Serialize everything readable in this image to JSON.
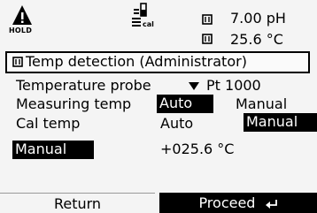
{
  "status": {
    "hold_label": "HOLD",
    "cal_label": "cal",
    "reading_1": "7.00 pH",
    "reading_2": "25.6 °C",
    "icons": [
      "warning-icon",
      "calibration-icon",
      "measurement-icon"
    ]
  },
  "title": {
    "text": "Temp detection (Administrator)"
  },
  "rows": {
    "probe_label": "Temperature probe",
    "probe_value": "Pt 1000",
    "measuring_label": "Measuring temp",
    "measuring_opt_1": "Auto",
    "measuring_opt_2": "Manual",
    "cal_label": "Cal temp",
    "cal_opt_1": "Auto",
    "cal_opt_2": "Manual",
    "manual_field": "Manual",
    "manual_value": "+025.6 °C"
  },
  "softkeys": {
    "left": "Return",
    "right": "Proceed"
  },
  "colors": {
    "selection_bg": "#000000",
    "selection_fg": "#ffffff",
    "screen_bg": "#f4f4f4"
  }
}
